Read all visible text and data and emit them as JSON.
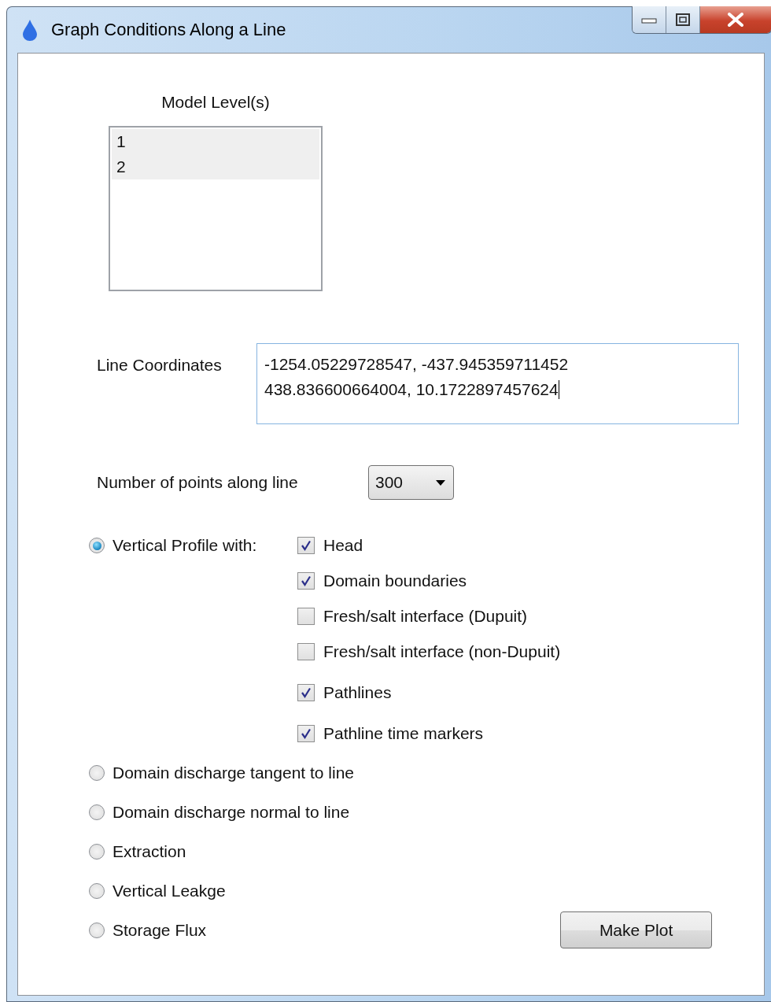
{
  "window": {
    "title": "Graph Conditions Along a Line"
  },
  "model_levels": {
    "label": "Model Level(s)",
    "items": [
      {
        "label": "1",
        "selected": true
      },
      {
        "label": "2",
        "selected": true
      }
    ]
  },
  "line_coordinates": {
    "label": "Line Coordinates",
    "value": "-1254.05229728547, -437.945359711452\n438.836600664004, 10.1722897457624"
  },
  "points": {
    "label": "Number of points along line",
    "value": "300"
  },
  "plot_types": [
    {
      "label": "Vertical Profile with:",
      "selected": true,
      "options": [
        {
          "label": "Head",
          "checked": true
        },
        {
          "label": "Domain boundaries",
          "checked": true
        },
        {
          "label": "Fresh/salt interface (Dupuit)",
          "checked": false
        },
        {
          "label": "Fresh/salt interface (non-Dupuit)",
          "checked": false
        },
        {
          "label": "Pathlines",
          "checked": true
        },
        {
          "label": "Pathline time markers",
          "checked": true
        }
      ]
    },
    {
      "label": "Domain discharge tangent to line",
      "selected": false
    },
    {
      "label": "Domain discharge normal to line",
      "selected": false
    },
    {
      "label": "Extraction",
      "selected": false
    },
    {
      "label": "Vertical Leakge",
      "selected": false
    },
    {
      "label": "Storage Flux",
      "selected": false
    }
  ],
  "buttons": [
    {
      "label": "Make Plot"
    }
  ]
}
